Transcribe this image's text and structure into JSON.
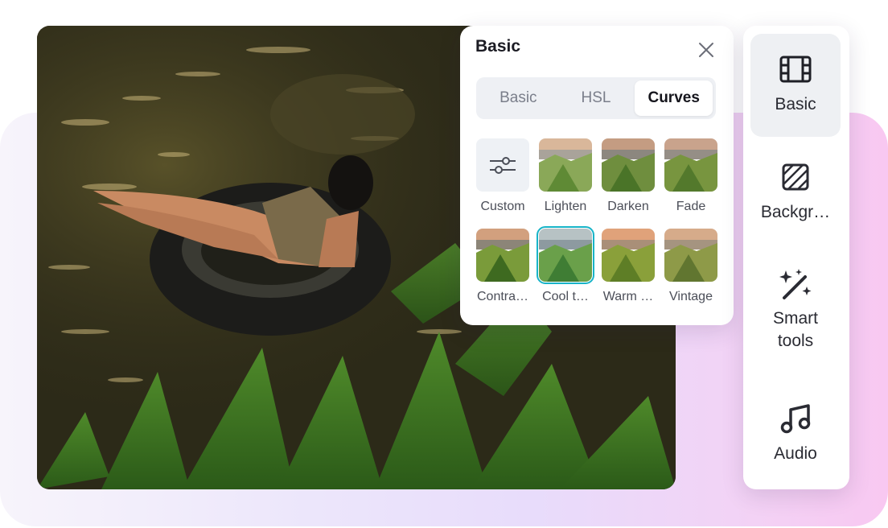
{
  "panel": {
    "title": "Basic",
    "tabs": [
      "Basic",
      "HSL",
      "Curves"
    ],
    "active_tab": "Curves",
    "presets": [
      {
        "label": "Custom",
        "icon": "sliders-icon"
      },
      {
        "label": "Lighten"
      },
      {
        "label": "Darken"
      },
      {
        "label": "Fade"
      },
      {
        "label": "Contra…"
      },
      {
        "label": "Cool t…",
        "selected": true
      },
      {
        "label": "Warm …"
      },
      {
        "label": "Vintage"
      }
    ]
  },
  "sidebar": {
    "items": [
      {
        "label": "Basic",
        "icon": "film-icon",
        "active": true
      },
      {
        "label": "Backgr…",
        "icon": "background-icon"
      },
      {
        "label_line1": "Smart",
        "label_line2": "tools",
        "icon": "magic-wand-icon"
      },
      {
        "label": "Audio",
        "icon": "music-note-icon"
      }
    ]
  },
  "colors": {
    "accent_selected": "#18b4c8",
    "background_gradient_end": "#f8c8f1"
  }
}
